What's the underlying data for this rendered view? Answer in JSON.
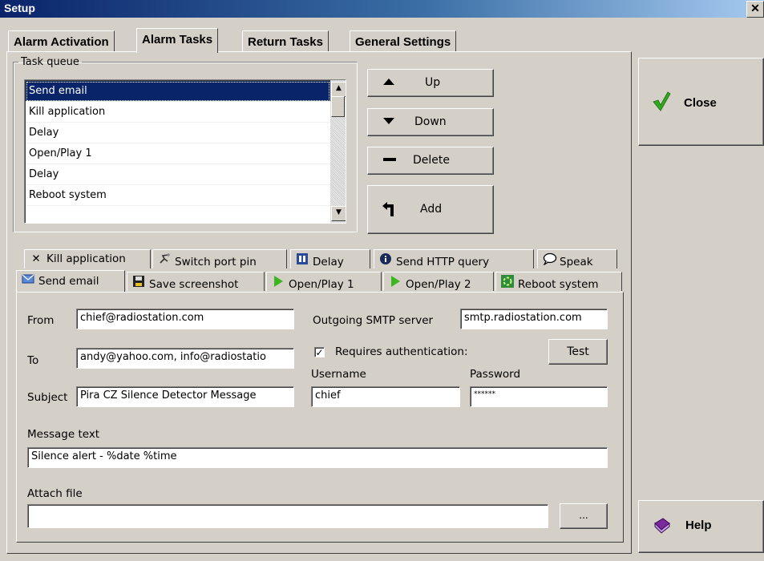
{
  "window": {
    "title": "Setup",
    "close_glyph": "✕"
  },
  "top_tabs": [
    {
      "label": "Alarm Activation"
    },
    {
      "label": "Alarm Tasks"
    },
    {
      "label": "Return Tasks"
    },
    {
      "label": "General Settings"
    }
  ],
  "task_queue": {
    "label": "Task queue",
    "items": [
      "Send email",
      "Kill application",
      "Delay",
      "Open/Play 1",
      "Delay",
      "Reboot system",
      ""
    ]
  },
  "queue_buttons": {
    "up": "Up",
    "down": "Down",
    "delete": "Delete",
    "add": "Add"
  },
  "sub_tabs_row1": [
    {
      "label": "Kill application",
      "icon": "x-icon"
    },
    {
      "label": "Switch port pin",
      "icon": "port-pin-icon"
    },
    {
      "label": "Delay",
      "icon": "pause-icon"
    },
    {
      "label": "Send HTTP query",
      "icon": "info-icon"
    },
    {
      "label": "Speak",
      "icon": "speech-bubble-icon"
    }
  ],
  "sub_tabs_row2": [
    {
      "label": "Send email",
      "icon": "envelope-icon"
    },
    {
      "label": "Save screenshot",
      "icon": "floppy-icon"
    },
    {
      "label": "Open/Play 1",
      "icon": "play-icon"
    },
    {
      "label": "Open/Play 2",
      "icon": "play-icon"
    },
    {
      "label": "Reboot system",
      "icon": "reboot-icon"
    }
  ],
  "email": {
    "from_label": "From",
    "from_value": "chief@radiostation.com",
    "to_label": "To",
    "to_value": "andy@yahoo.com, info@radiostatio",
    "subject_label": "Subject",
    "subject_value": "Pira CZ Silence Detector Message",
    "smtp_label": "Outgoing SMTP server",
    "smtp_value": "smtp.radiostation.com",
    "auth_label": "Requires authentication:",
    "auth_checked": true,
    "test_label": "Test",
    "username_label": "Username",
    "username_value": "chief",
    "password_label": "Password",
    "password_value": "******",
    "message_label": "Message text",
    "message_value": "Silence alert - %date %time",
    "attach_label": "Attach file",
    "attach_value": "",
    "browse_label": "..."
  },
  "side_buttons": {
    "close": "Close",
    "help": "Help"
  },
  "colors": {
    "selection": "#0a246a",
    "title_gradient_start": "#0a246a",
    "check_green": "#2eaa1e"
  }
}
